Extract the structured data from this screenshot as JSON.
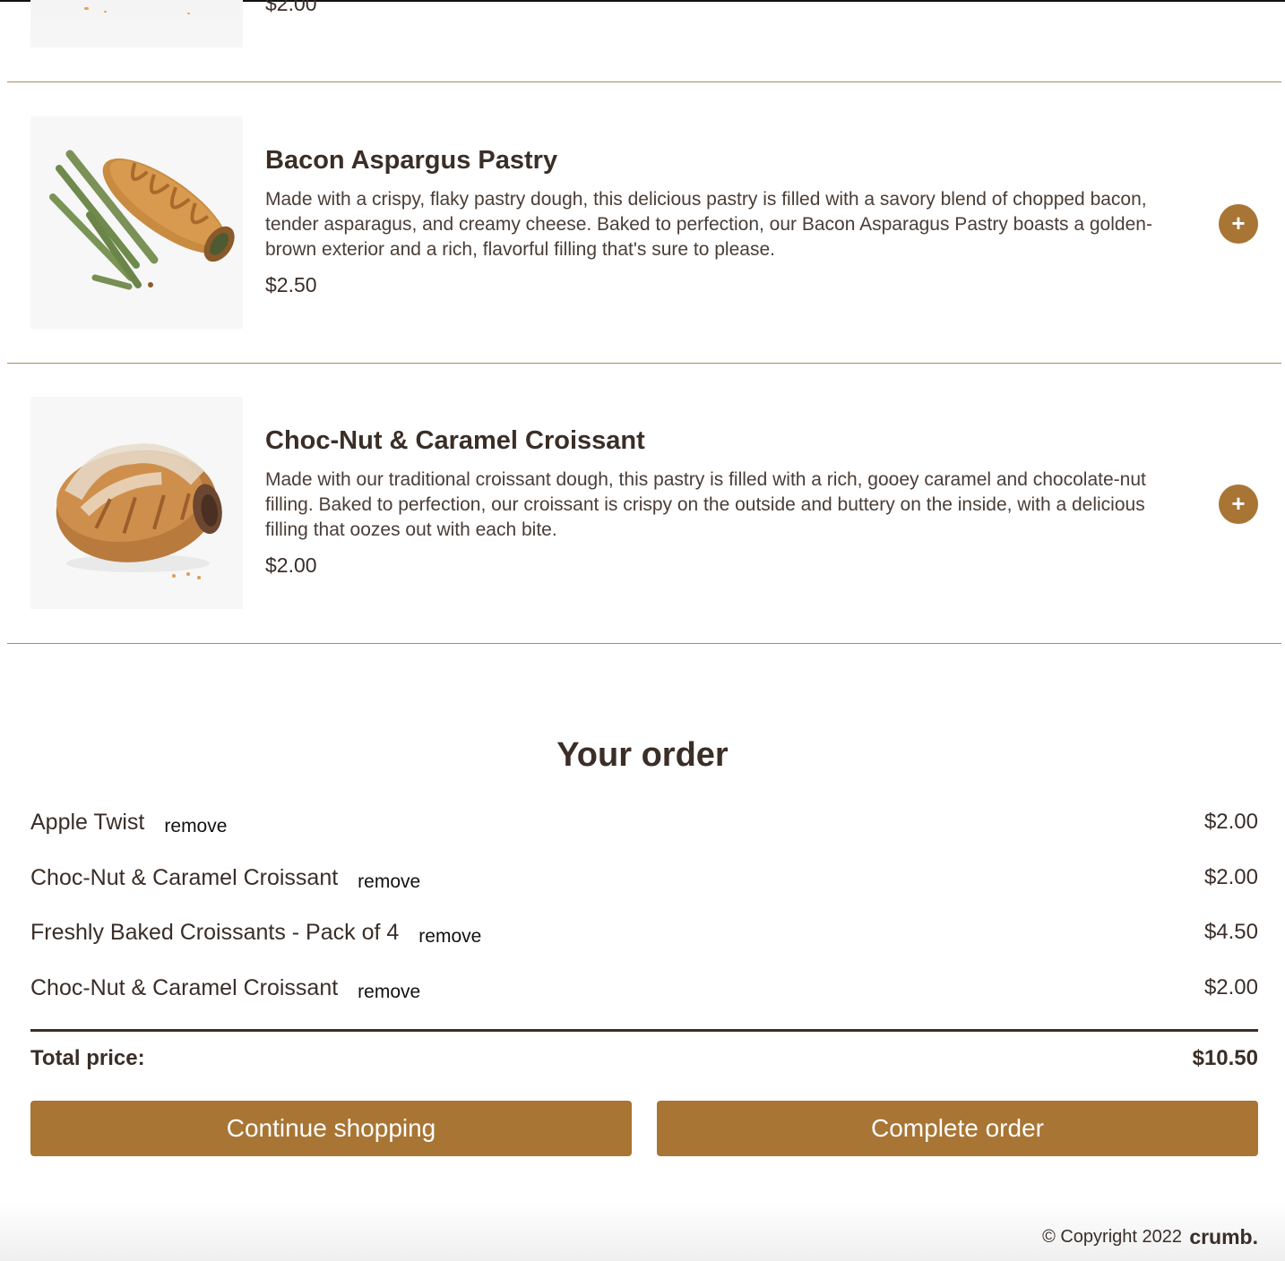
{
  "previous_item": {
    "price": "$2.00"
  },
  "menu": {
    "items": [
      {
        "name": "Bacon Aspargus Pastry",
        "description": "Made with a crispy, flaky pastry dough, this delicious pastry is filled with a savory blend of chopped bacon, tender asparagus, and creamy cheese. Baked to perfection, our Bacon Asparagus Pastry boasts a golden-brown exterior and a rich, flavorful filling that's sure to please.",
        "price": "$2.50",
        "add_icon": "+"
      },
      {
        "name": "Choc-Nut & Caramel Croissant",
        "description": "Made with our traditional croissant dough, this pastry is filled with a rich, gooey caramel and chocolate-nut filling. Baked to perfection, our croissant is crispy on the outside and buttery on the inside, with a delicious filling that oozes out with each bite.",
        "price": "$2.00",
        "add_icon": "+"
      }
    ]
  },
  "order": {
    "title": "Your order",
    "remove_label": "remove",
    "items": [
      {
        "name": "Apple Twist",
        "price": "$2.00"
      },
      {
        "name": "Choc-Nut & Caramel Croissant",
        "price": "$2.00"
      },
      {
        "name": "Freshly Baked Croissants - Pack of 4",
        "price": "$4.50"
      },
      {
        "name": "Choc-Nut & Caramel Croissant",
        "price": "$2.00"
      }
    ],
    "total_label": "Total price:",
    "total_price": "$10.50",
    "continue_label": "Continue shopping",
    "complete_label": "Complete order"
  },
  "footer": {
    "copyright": "© Copyright 2022",
    "brand": "crumb."
  },
  "colors": {
    "accent": "#a87535",
    "text": "#3a2e27",
    "divider": "#b08a5a"
  }
}
